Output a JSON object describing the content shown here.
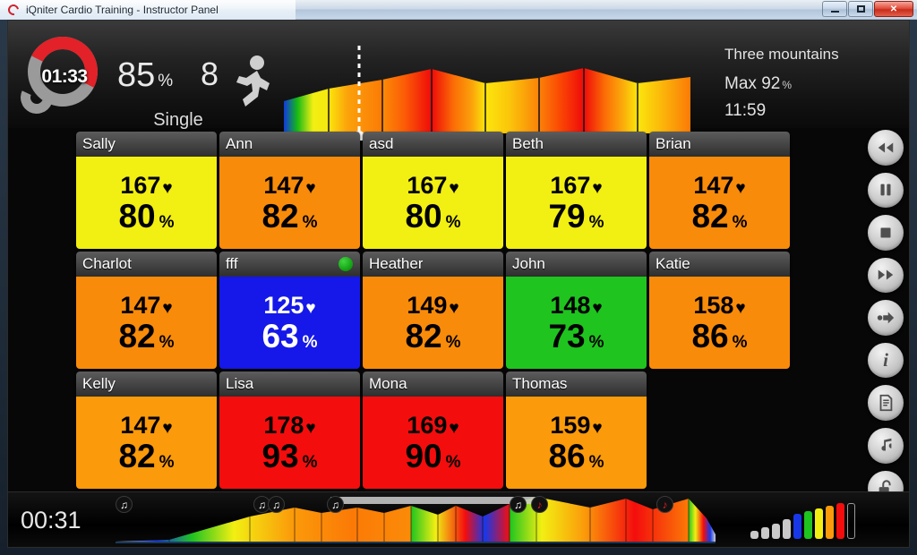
{
  "window": {
    "title": "iQniter Cardio Training - Instructor Panel",
    "minimize_label": "Minimize",
    "maximize_label": "Maximize",
    "close_label": "✕"
  },
  "header": {
    "elapsed_timer": "01:33",
    "avg_intensity": "85",
    "avg_intensity_unit": "%",
    "participant_count": "8",
    "mode": "Single",
    "activity_icon": "runner-icon"
  },
  "session": {
    "name": "Three mountains",
    "max_label": "Max",
    "max_value": "92",
    "max_unit": "%",
    "duration": "11:59"
  },
  "profile_graph": {
    "playhead_position_pct": 18,
    "segments": [
      {
        "height_pct": 40,
        "colors": [
          "#1139e0",
          "#15b915",
          "#f2ef12",
          "#f6e80e"
        ]
      },
      {
        "height_pct": 55,
        "colors": [
          "#fbe60c",
          "#fba20a",
          "#fb8b08",
          "#fb7a06"
        ]
      },
      {
        "height_pct": 62,
        "colors": [
          "#fb8b08",
          "#fb5c05",
          "#f71c0c",
          "#ef0a0a"
        ]
      },
      {
        "height_pct": 72,
        "colors": [
          "#ef0a0a",
          "#fb6b06",
          "#fba20a",
          "#fbe60c"
        ]
      },
      {
        "height_pct": 52,
        "colors": [
          "#fbe60c",
          "#fbc50a",
          "#fb9a08",
          "#fb8208"
        ]
      },
      {
        "height_pct": 58,
        "colors": [
          "#fb8208",
          "#fb4a04",
          "#ef0a0a",
          "#ef0a0a"
        ]
      },
      {
        "height_pct": 72,
        "colors": [
          "#ef0a0a",
          "#fb6b06",
          "#fbaa0a",
          "#fbe60c"
        ]
      },
      {
        "height_pct": 53,
        "colors": [
          "#fbe60c",
          "#fbb80a",
          "#fb8b08",
          "#fb7a06"
        ]
      }
    ]
  },
  "participants": {
    "rows": [
      [
        {
          "name": "Sally",
          "hr": "167",
          "pct": "80",
          "zone_color": "#f2ef12",
          "text_color": "#000000",
          "status_dot": false
        },
        {
          "name": "Ann",
          "hr": "147",
          "pct": "82",
          "zone_color": "#f98b0a",
          "text_color": "#000000",
          "status_dot": false
        },
        {
          "name": "asd",
          "hr": "167",
          "pct": "80",
          "zone_color": "#f2ef12",
          "text_color": "#000000",
          "status_dot": false
        },
        {
          "name": "Beth",
          "hr": "167",
          "pct": "79",
          "zone_color": "#f2ef12",
          "text_color": "#000000",
          "status_dot": false
        },
        {
          "name": "Brian",
          "hr": "147",
          "pct": "82",
          "zone_color": "#f98b0a",
          "text_color": "#000000",
          "status_dot": false
        }
      ],
      [
        {
          "name": "Charlot",
          "hr": "147",
          "pct": "82",
          "zone_color": "#f98b0a",
          "text_color": "#000000",
          "status_dot": false
        },
        {
          "name": "fff",
          "hr": "125",
          "pct": "63",
          "zone_color": "#1518e8",
          "text_color": "#ffffff",
          "status_dot": true
        },
        {
          "name": "Heather",
          "hr": "149",
          "pct": "82",
          "zone_color": "#f98b0a",
          "text_color": "#000000",
          "status_dot": false
        },
        {
          "name": "John",
          "hr": "148",
          "pct": "73",
          "zone_color": "#1fc41f",
          "text_color": "#000000",
          "status_dot": false
        },
        {
          "name": "Katie",
          "hr": "158",
          "pct": "86",
          "zone_color": "#f98b0a",
          "text_color": "#000000",
          "status_dot": false
        }
      ],
      [
        {
          "name": "Kelly",
          "hr": "147",
          "pct": "82",
          "zone_color": "#fb9a0a",
          "text_color": "#000000",
          "status_dot": false
        },
        {
          "name": "Lisa",
          "hr": "178",
          "pct": "93",
          "zone_color": "#f40d0d",
          "text_color": "#000000",
          "status_dot": false
        },
        {
          "name": "Mona",
          "hr": "169",
          "pct": "90",
          "zone_color": "#f40d0d",
          "text_color": "#000000",
          "status_dot": false
        },
        {
          "name": "Thomas",
          "hr": "159",
          "pct": "86",
          "zone_color": "#fb9a0a",
          "text_color": "#000000",
          "status_dot": false
        }
      ]
    ],
    "heart_glyph": "♥",
    "percent_glyph": "%"
  },
  "bottom": {
    "clock": "00:31",
    "music_markers": [
      {
        "x_pct": 3,
        "glyph": "♫",
        "muted": false
      },
      {
        "x_pct": 34,
        "glyph": "♫",
        "muted": false
      },
      {
        "x_pct": 38,
        "glyph": "♫",
        "muted": false
      },
      {
        "x_pct": 45,
        "glyph": "♫",
        "muted": false
      },
      {
        "x_pct": 73,
        "glyph": "♫",
        "muted": false
      },
      {
        "x_pct": 77,
        "glyph": "♪",
        "muted": true
      },
      {
        "x_pct": 95,
        "glyph": "♪",
        "muted": true
      }
    ],
    "zone_bars": [
      {
        "height_pct": 22,
        "color": "#c9c9c9"
      },
      {
        "height_pct": 32,
        "color": "#c9c9c9"
      },
      {
        "height_pct": 43,
        "color": "#c9c9c9"
      },
      {
        "height_pct": 55,
        "color": "#c9c9c9"
      },
      {
        "height_pct": 70,
        "color": "#1838e8"
      },
      {
        "height_pct": 78,
        "color": "#1fc41f"
      },
      {
        "height_pct": 86,
        "color": "#f2ef12"
      },
      {
        "height_pct": 93,
        "color": "#fb9a0a"
      },
      {
        "height_pct": 100,
        "color": "#f40d0d"
      },
      {
        "height_pct": 100,
        "color": "transparent"
      }
    ]
  },
  "rail": {
    "buttons": [
      {
        "name": "rewind-button",
        "label": "Rewind"
      },
      {
        "name": "pause-button",
        "label": "Pause"
      },
      {
        "name": "stop-button",
        "label": "Stop"
      },
      {
        "name": "fast-forward-button",
        "label": "Fast forward"
      },
      {
        "name": "next-segment-button",
        "label": "Next segment"
      },
      {
        "name": "info-button",
        "label": "i"
      },
      {
        "name": "report-button",
        "label": "Report"
      },
      {
        "name": "music-button",
        "label": "Music"
      },
      {
        "name": "unlock-button",
        "label": "Unlock"
      }
    ]
  }
}
